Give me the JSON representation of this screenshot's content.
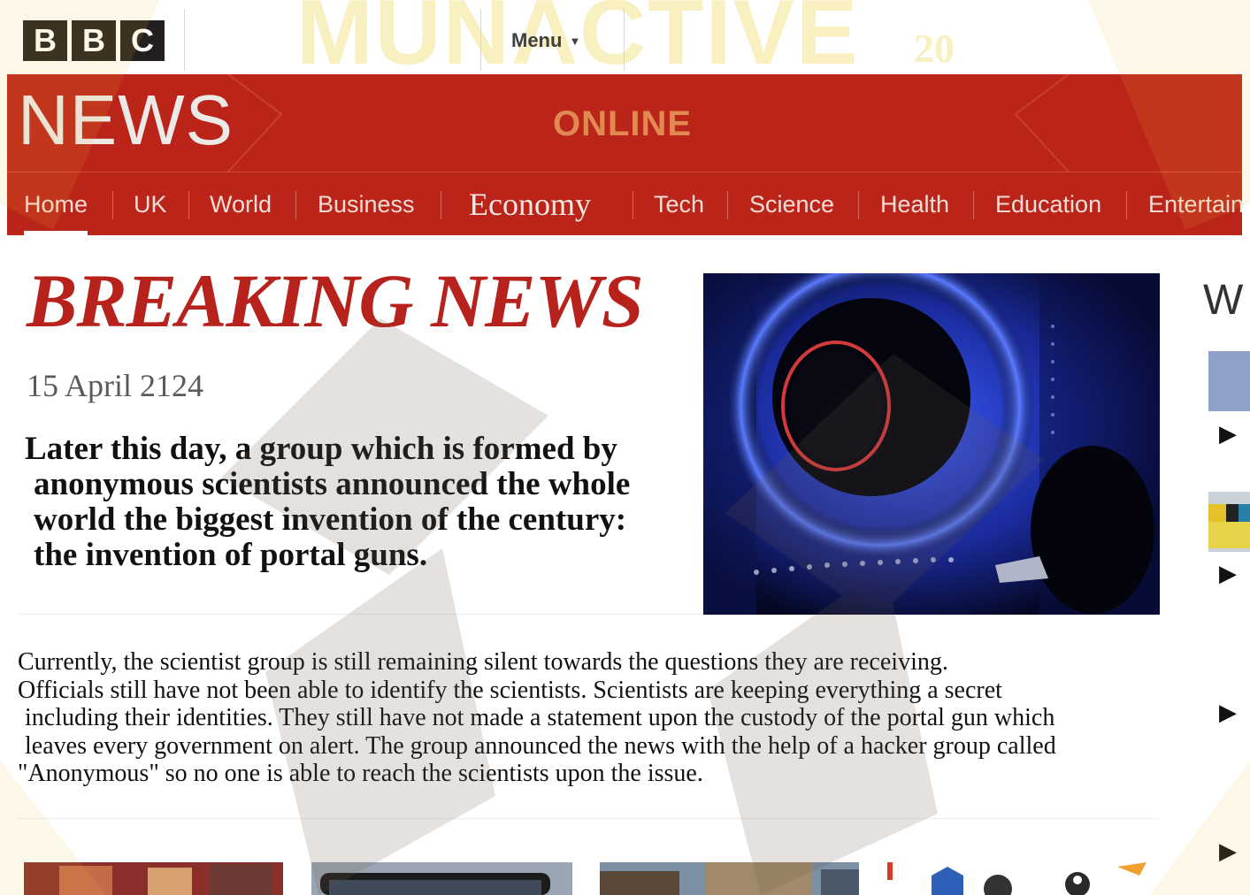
{
  "watermark": {
    "text": "MUNACTIVE",
    "year": "20"
  },
  "header": {
    "logo_letters": [
      "B",
      "B",
      "C"
    ],
    "menu_label": "Menu",
    "news_wordmark": "NEWS",
    "online_label": "ONLINE"
  },
  "nav": {
    "items": [
      {
        "label": "Home"
      },
      {
        "label": "UK"
      },
      {
        "label": "World"
      },
      {
        "label": "Business"
      },
      {
        "label": "Economy"
      },
      {
        "label": "Tech"
      },
      {
        "label": "Science"
      },
      {
        "label": "Health"
      },
      {
        "label": "Education"
      },
      {
        "label": "Entertain"
      }
    ],
    "active": "Home"
  },
  "article": {
    "headline": "BREAKING NEWS",
    "date": "15 April 2124",
    "lead_lines": [
      "Later this day, a group which is formed by",
      "anonymous scientists announced the whole",
      "world the biggest invention of the century:",
      "the invention of portal guns."
    ],
    "body_lines": [
      "Currently, the scientist group is still remaining silent towards the questions they are receiving.",
      "Officials still have not been able to identify the scientists. Scientists are keeping everything a secret",
      "including their identities. They still have not made a statement upon the custody of the portal gun which",
      "leaves every government on alert. The group announced the news with the help of a hacker group called",
      "\"Anonymous\" so no one is able to reach the scientists upon the issue."
    ]
  },
  "right_rail": {
    "heading": "W"
  },
  "colors": {
    "bbc_red": "#bb2418",
    "headline_red": "#b8221c",
    "watermark_yellow": "#f6eaa8"
  }
}
